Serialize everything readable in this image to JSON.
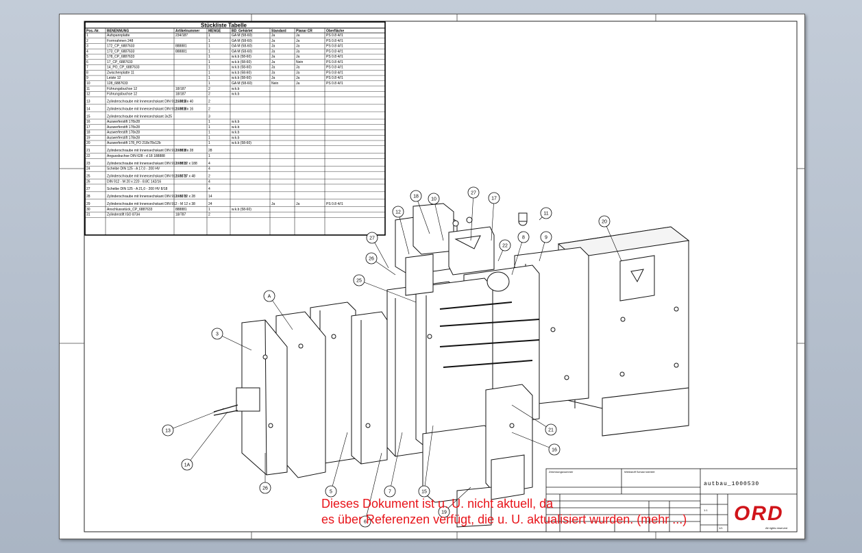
{
  "bom": {
    "title": "Stückliste Tabelle",
    "headers": [
      "Pos.-Nr.",
      "BENENNUNG",
      "Artikelnummer",
      "MENGE",
      "BD_Gehärtet",
      "Standard",
      "Planar CR",
      "Oberfläche"
    ],
    "rows": [
      [
        "1",
        "Aufspannplatte",
        "234/187",
        "1",
        "GA M (58-60)",
        "Ja",
        "Ja",
        "PS 0.8 4//1"
      ],
      [
        "2",
        "Formrahmen 248",
        "",
        "1",
        "GA M (58-60)",
        "Ja",
        "Ja",
        "PS 0.8 4//1"
      ],
      [
        "3",
        "172_CP_6887633",
        "888881",
        "1",
        "GA M (58-60)",
        "Ja",
        "Ja",
        "PS 0.8 4//1"
      ],
      [
        "4",
        "173_CP_6887633",
        "888881",
        "1",
        "GA M (58-60)",
        "Ja",
        "Ja",
        "PS 0.8 4//1"
      ],
      [
        "5",
        "178_CP_6887633",
        "",
        "1",
        "w.k.b (58-60)",
        "Ja",
        "Ja",
        "PS 0.8 4//1"
      ],
      [
        "6",
        "17_CP_6887633",
        "",
        "1",
        "w.k.b (58-60)",
        "Ja",
        "Nein",
        "PS 0.8 4//1"
      ],
      [
        "7",
        "14_PO_CP_6887633",
        "",
        "1",
        "w.k.b (58-60)",
        "Ja",
        "Ja",
        "PS 0.8 4//1"
      ],
      [
        "8",
        "Zwischenplatte 11",
        "",
        "1",
        "w.k.b (58-60)",
        "Ja",
        "Ja",
        "PS 0.8 4//1"
      ],
      [
        "9",
        "Leiste 12",
        "",
        "1",
        "w.k.b (58-60)",
        "Ja",
        "Ja",
        "PS 0.8 4//1"
      ],
      [
        "10",
        "128_6887633",
        "",
        "1",
        "GA M (58-60)",
        "Nein",
        "Ja",
        "PS 0.8 4//1"
      ],
      [
        "11",
        "Führungsbuchse 12",
        "18/187",
        "2",
        "w.k.b",
        "",
        "",
        ""
      ],
      [
        "12",
        "Führungsbuchse 12",
        "18/187",
        "2",
        "w.k.b",
        "",
        "",
        ""
      ],
      [
        "13",
        "Zylinderschraube mit Innensechskant DIN 912 - M 8 x 40",
        "188818",
        "2",
        "",
        "",
        "",
        ""
      ],
      [
        "14",
        "Zylinderschraube mit Innensechskant DIN 912 - M 8 x 16",
        "188818",
        "2",
        "",
        "",
        "",
        ""
      ],
      [
        "15",
        "Zylinderschraube mit Innensechskant 3x25",
        "",
        "3",
        "",
        "",
        "",
        ""
      ],
      [
        "16",
        "Auswerferstift 178x28",
        "",
        "1",
        "w.k.b",
        "",
        "",
        ""
      ],
      [
        "17",
        "Auswerferstift 178x28",
        "",
        "1",
        "w.k.b",
        "",
        "",
        ""
      ],
      [
        "18",
        "Auswerferstift 178x28",
        "",
        "1",
        "w.k.b",
        "",
        "",
        ""
      ],
      [
        "19",
        "Auswerferstift 178x28",
        "",
        "1",
        "w.k.b",
        "",
        "",
        ""
      ],
      [
        "20",
        "Auswerferstift 178_PO 218x78x12b",
        "",
        "1",
        "w.k.b (58-60)",
        "",
        "",
        ""
      ],
      [
        "21",
        "Zylinderschraube mit Innensechskant DIN 912 - M 8 x 28",
        "188818",
        "28",
        "",
        "",
        "",
        ""
      ],
      [
        "22",
        "Angussbuchse DIN 628 - d 18 188888",
        "",
        "1",
        "",
        "",
        "",
        ""
      ],
      [
        "23",
        "Zylinderschraube mit Innensechskant DIN 912 - M 12 x 188",
        "188818",
        "4",
        "",
        "",
        "",
        ""
      ],
      [
        "24",
        "Scheibe DIN 125 - A 17,0 - 200 HV",
        "",
        "4",
        "",
        "",
        "",
        ""
      ],
      [
        "25",
        "Zylinderschraube mit Innensechskant DIN 912 - M 17 x 48",
        "188178",
        "2",
        "",
        "",
        "",
        ""
      ],
      [
        "26",
        "DIN 912 - M 20 x 220 - 8.8C 142/16",
        "",
        "4",
        "",
        "",
        "",
        ""
      ],
      [
        "27",
        "Scheibe DIN 125 - A 21,0 - 200 HV 8/18",
        "",
        "4",
        "",
        "",
        "",
        ""
      ],
      [
        "28",
        "Zylinderschraube mit Innensechskant DIN 912 - M 12 x 28",
        "188178",
        "14",
        "",
        "",
        "",
        ""
      ],
      [
        "29",
        "Zylinderschraube mit Innensechskant DIN 912 - M 12 x 38",
        "",
        "24",
        "",
        "Ja",
        "Ja",
        "PS 0.8 4//1"
      ],
      [
        "30",
        "Anschlussstück_CP_6887633",
        "888881",
        "1",
        "w.k.b (58-60)",
        "",
        "",
        ""
      ],
      [
        "31",
        "Zylinderstift ISO 8734",
        "18/787",
        "2",
        "",
        "",
        "",
        ""
      ]
    ]
  },
  "balloons": [
    "18",
    "10",
    "27",
    "17",
    "11",
    "12",
    "27",
    "26",
    "22",
    "8",
    "9",
    "20",
    "25",
    "A",
    "3",
    "13",
    "1A",
    "26",
    "5",
    "6",
    "7",
    "15",
    "19",
    "21",
    "16"
  ],
  "titleblock": {
    "drawing_name": "autbau_1000530",
    "company": "ORD",
    "label_a": "Zeichnungsnummer",
    "label_b": "Werkstoff Schutz toleriert",
    "rights": "All rights reserved",
    "scale": "1:1",
    "sheet": "1/1"
  },
  "warning": {
    "line1": "Dieses Dokument ist u. U. nicht aktuell, da",
    "line2": "es über Referenzen verfügt, die u. U. aktualisiert wurden. (mehr ...)"
  },
  "colors": {
    "background": "#b8c2d0",
    "sheet": "#ffffff",
    "warning": "#e8141a",
    "logo": "#d0141a"
  }
}
